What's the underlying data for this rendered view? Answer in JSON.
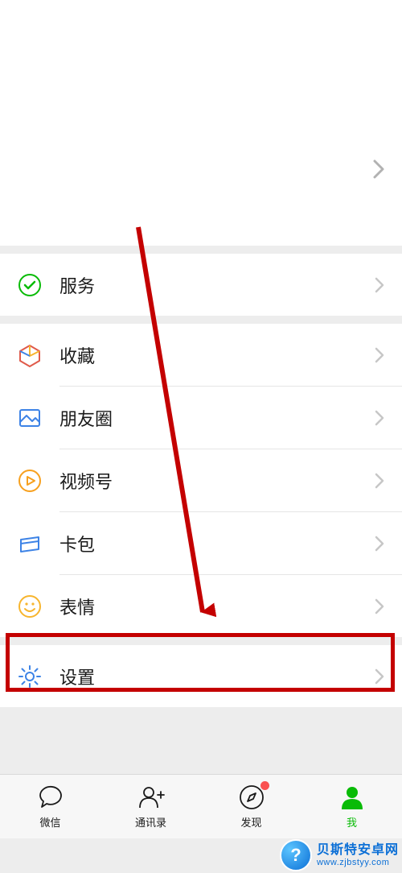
{
  "menu": {
    "services": "服务",
    "favorites": "收藏",
    "moments": "朋友圈",
    "channels": "视频号",
    "cards": "卡包",
    "stickers": "表情",
    "settings": "设置"
  },
  "tabs": {
    "wechat": "微信",
    "contacts": "通讯录",
    "discover": "发现",
    "me": "我"
  },
  "watermark": {
    "line1": "贝斯特安卓网",
    "line2": "www.zjbstyy.com"
  },
  "colors": {
    "accent_green": "#09bb07",
    "highlight_red": "#c40000",
    "icon_blue": "#3d83e6",
    "icon_yellow": "#f7b52e",
    "badge_red": "#fa5151"
  }
}
